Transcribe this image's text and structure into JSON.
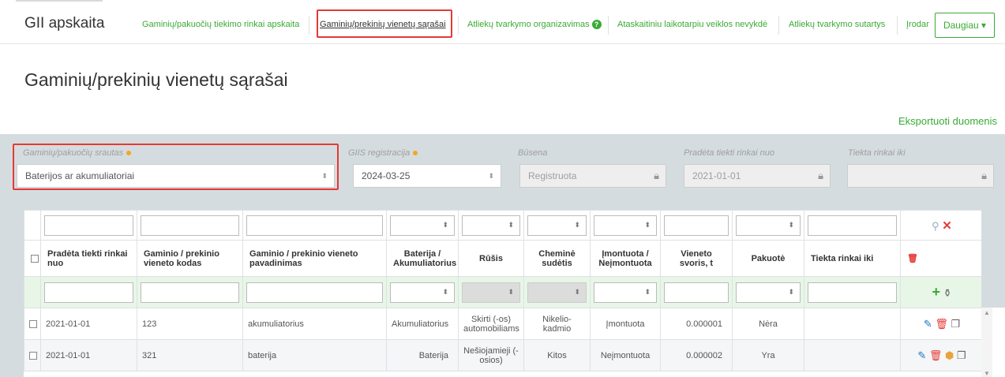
{
  "app": {
    "brand": "GII apskaita"
  },
  "nav": {
    "items": [
      "Gaminių/pakuočių tiekimo rinkai apskaita",
      "Gaminių/prekinių vienetų sąrašai",
      "Atliekų tvarkymo organizavimas",
      "Ataskaitiniu laikotarpiu veiklos nevykdė",
      "Atliekų tvarkymo sutartys",
      "Įrodar"
    ],
    "help_glyph": "?",
    "more_label": "Daugiau ▾"
  },
  "page": {
    "title": "Gaminių/prekinių vienetų sąrašai",
    "export_label": "Eksportuoti duomenis"
  },
  "filters": {
    "stream": {
      "label": "Gaminių/pakuočių srautas",
      "value": "Baterijos ar akumuliatoriai"
    },
    "giis": {
      "label": "GIIS registracija",
      "value": "2024-03-25"
    },
    "status": {
      "label": "Būsena",
      "value": "Registruota"
    },
    "start": {
      "label": "Pradėta tiekti rinkai nuo",
      "value": "2021-01-01"
    },
    "end": {
      "label": "Tiekta rinkai iki",
      "value": ""
    }
  },
  "table": {
    "columns": [
      "Pradėta tiekti rinkai nuo",
      "Gaminio / prekinio vieneto kodas",
      "Gaminio / prekinio vieneto pavadinimas",
      "Baterija / Akumuliatorius",
      "Rūšis",
      "Cheminė sudėtis",
      "Įmontuota / Neįmontuota",
      "Vieneto svoris, t",
      "Pakuotė",
      "Tiekta rinkai iki"
    ],
    "rows": [
      {
        "start": "2021-01-01",
        "code": "123",
        "name": "akumuliatorius",
        "type": "Akumuliatorius",
        "kind": "Skirti (-os) automobiliams",
        "chem": "Nikelio-kadmio",
        "mounted": "Įmontuota",
        "weight": "0.000001",
        "pack": "Nėra",
        "end": ""
      },
      {
        "start": "2021-01-01",
        "code": "321",
        "name": "baterija",
        "type": "Baterija",
        "kind": "Nešiojamieji (-osios)",
        "chem": "Kitos",
        "mounted": "Neįmontuota",
        "weight": "0.000002",
        "pack": "Yra",
        "end": ""
      }
    ]
  },
  "icons": {
    "lock": "lock-icon",
    "search": "search-icon",
    "clear": "close-icon",
    "delete": "trash-icon",
    "add": "plus-icon",
    "import": "import-icon",
    "edit": "pencil-icon",
    "copy": "copy-icon",
    "package": "package-icon"
  },
  "colors": {
    "accent": "#3aaa35",
    "danger": "#e53935",
    "panel": "#d5dcdf",
    "required": "#f5a623"
  }
}
